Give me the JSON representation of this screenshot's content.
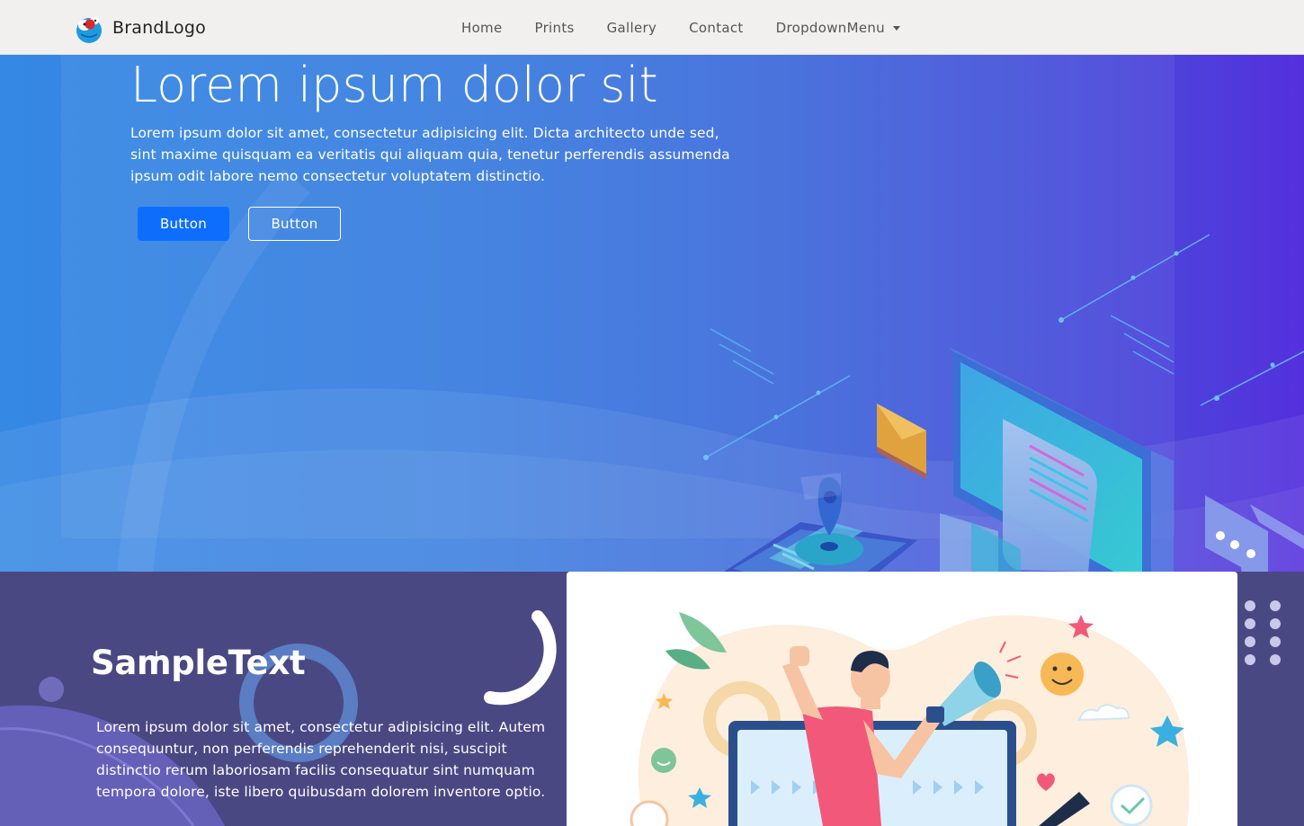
{
  "navbar": {
    "brand": "BrandLogo",
    "links": [
      {
        "label": "Home"
      },
      {
        "label": "Prints"
      },
      {
        "label": "Gallery"
      },
      {
        "label": "Contact"
      }
    ],
    "dropdown_label": "DropdownMenu"
  },
  "hero": {
    "title": "Lorem ipsum dolor sit",
    "text": "Lorem ipsum dolor sit amet, consectetur adipisicing elit. Dicta architecto unde sed, sint maxime quisquam ea veritatis qui aliquam quia, tenetur perferendis assumenda ipsum odit labore nemo consectetur voluptatem distinctio.",
    "primary_button": "Button",
    "secondary_button": "Button"
  },
  "section": {
    "title": "SampleText",
    "text": "Lorem ipsum dolor sit amet, consectetur adipisicing elit. Autem consequuntur, non perferendis reprehenderit nisi, suscipit distinctio rerum laboriosam facilis consequatur sint numquam tempora dolore, iste libero quibusdam dolorem inventore optio."
  },
  "colors": {
    "navbar_bg": "#f1f0ef",
    "hero_gradient_start": "#3588e4",
    "hero_gradient_end": "#5430dd",
    "primary_button": "#0d6efd",
    "section_bg": "#4a4883",
    "card_bg": "#ffffff"
  },
  "icons": {
    "brand": "cartoon-logo-icon",
    "dropdown": "caret-down-icon"
  }
}
